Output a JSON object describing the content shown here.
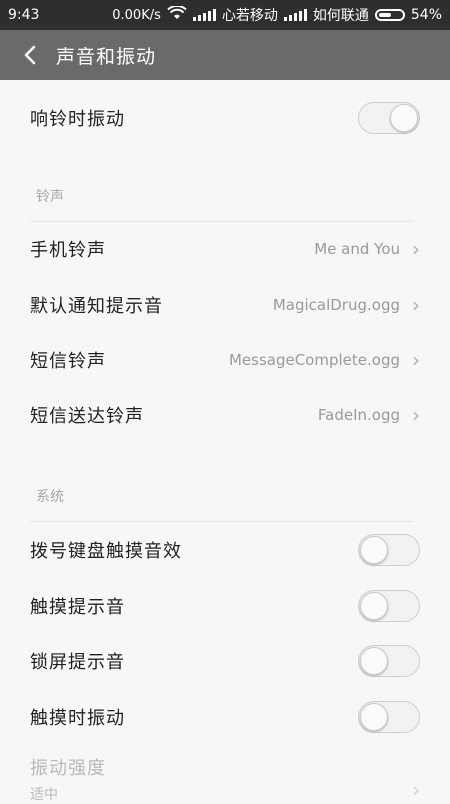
{
  "status_bar": {
    "time": "9:43",
    "speed": "0.00K/s",
    "carrier1": "心若移动",
    "carrier2": "如何联通",
    "battery": "54%",
    "battery_level": 0.54
  },
  "header": {
    "title": "声音和振动"
  },
  "vibrate_on_ring": {
    "label": "响铃时振动",
    "on": true
  },
  "ringtone_section": {
    "title": "铃声",
    "items": [
      {
        "label": "手机铃声",
        "value": "Me and You"
      },
      {
        "label": "默认通知提示音",
        "value": "MagicalDrug.ogg"
      },
      {
        "label": "短信铃声",
        "value": "MessageComplete.ogg"
      },
      {
        "label": "短信送达铃声",
        "value": "FadeIn.ogg"
      }
    ]
  },
  "system_section": {
    "title": "系统",
    "items": [
      {
        "label": "拨号键盘触摸音效",
        "on": false
      },
      {
        "label": "触摸提示音",
        "on": false
      },
      {
        "label": "锁屏提示音",
        "on": false
      },
      {
        "label": "触摸时振动",
        "on": false
      }
    ]
  },
  "vibration_strength": {
    "label": "振动强度",
    "value": "适中"
  }
}
